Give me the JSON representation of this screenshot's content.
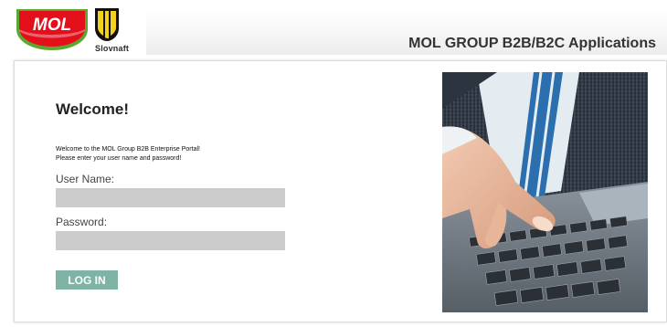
{
  "header": {
    "logo_text": "MOL",
    "slovnaft_text": "Slovnaft",
    "app_title": "MOL GROUP B2B/B2C Applications"
  },
  "login": {
    "welcome": "Welcome!",
    "intro_line1": "Welcome to the MOL Group B2B Enterprise Portal!",
    "intro_line2": "Please enter your user name and password!",
    "username_label": "User Name:",
    "username_value": "",
    "password_label": "Password:",
    "password_value": "",
    "login_button": "LOG IN"
  },
  "colors": {
    "mol_red": "#e3101c",
    "mol_green": "#5aa832",
    "slovnaft_yellow": "#f2d21b",
    "button_teal": "#7eb3a5",
    "field_gray": "#cccccc"
  }
}
